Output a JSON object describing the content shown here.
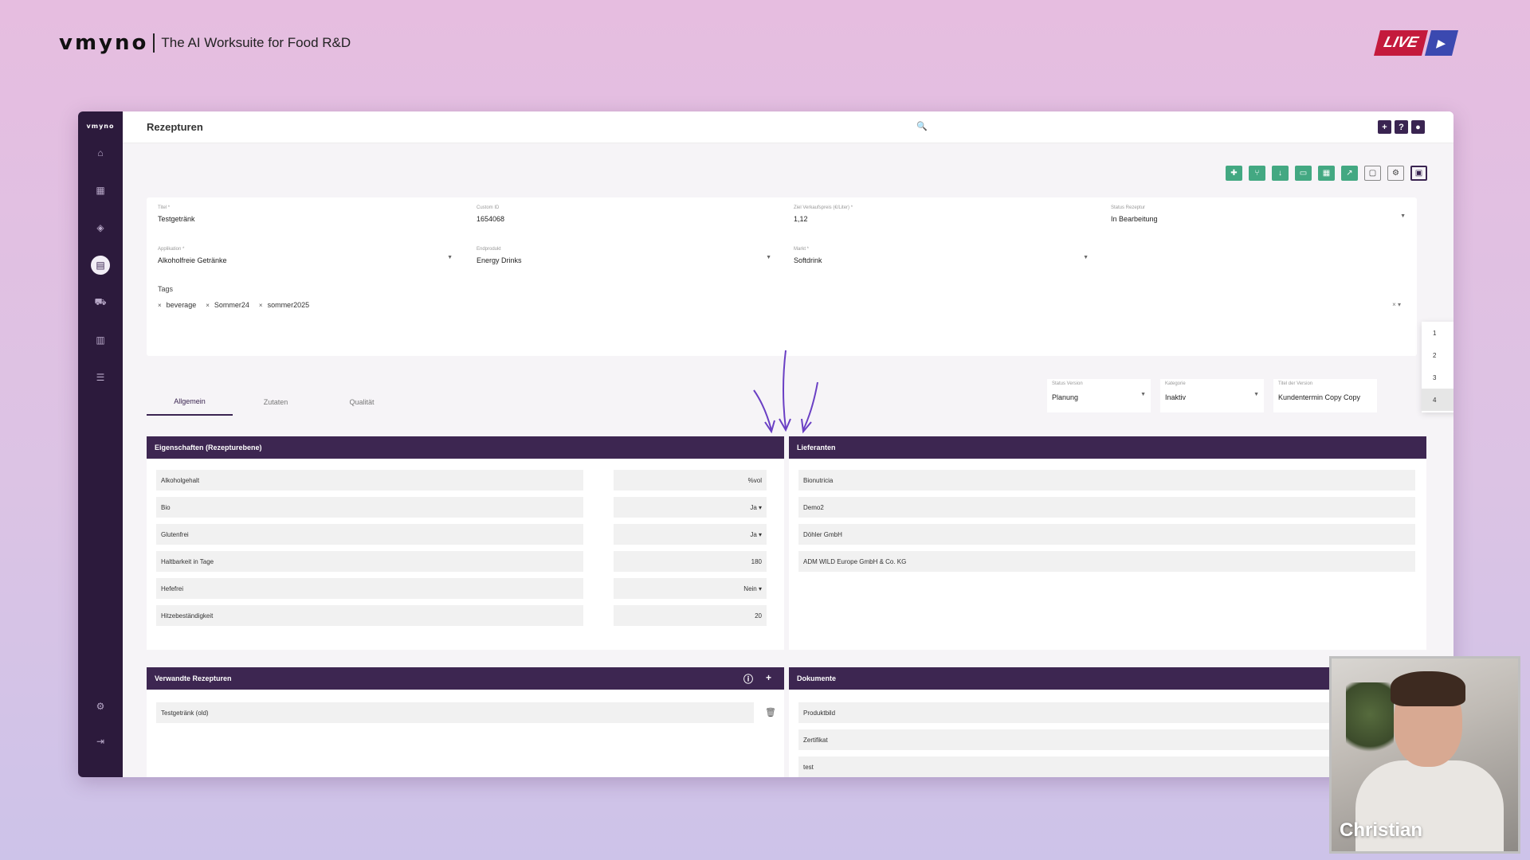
{
  "brand": {
    "logo": "vmyno",
    "tagline": "The AI Worksuite for Food R&D"
  },
  "live_badge": {
    "label": "LIVE"
  },
  "app": {
    "sidebar": {
      "logo": "vmyno",
      "items": [
        "home-icon",
        "grid-icon",
        "layers-icon",
        "recipe-icon",
        "truck-icon",
        "book-icon",
        "search-list-icon",
        "settings-icon",
        "logout-icon"
      ],
      "active": "recipe-icon"
    },
    "page_title": "Rezepturen",
    "top_actions": [
      "+",
      "?",
      "user-icon"
    ],
    "form": {
      "titel": {
        "label": "Titel *",
        "value": "Testgetränk"
      },
      "custom_id": {
        "label": "Custom ID",
        "value": "1654068"
      },
      "price": {
        "label": "Ziel Verkaufspreis (€/Liter) *",
        "value": "1,12"
      },
      "status": {
        "label": "Status Rezeptur",
        "value": "In Bearbeitung"
      },
      "applikation": {
        "label": "Applikation *",
        "value": "Alkoholfreie Getränke"
      },
      "endprodukt": {
        "label": "Endprodukt",
        "value": "Energy Drinks"
      },
      "markt": {
        "label": "Markt *",
        "value": "Softdrink"
      },
      "tags_label": "Tags",
      "tags": [
        "beverage",
        "Sommer24",
        "sommer2025"
      ]
    },
    "version_dropdown": [
      "1",
      "2",
      "3",
      "4"
    ],
    "tabs": [
      "Allgemein",
      "Zutaten",
      "Qualität"
    ],
    "version_fields": {
      "status_version": {
        "label": "Status Version",
        "value": "Planung"
      },
      "kategorie": {
        "label": "Kategorie",
        "value": "Inaktiv"
      },
      "titel_version": {
        "label": "Titel der Version",
        "value": "Kundentermin Copy Copy"
      }
    },
    "eigenschaften": {
      "title": "Eigenschaften (Rezepturebene)",
      "rows": [
        {
          "name": "Alkoholgehalt",
          "value": "%vol"
        },
        {
          "name": "Bio",
          "value": "Ja ▾"
        },
        {
          "name": "Glutenfrei",
          "value": "Ja ▾"
        },
        {
          "name": "Haltbarkeit in Tage",
          "value": "180"
        },
        {
          "name": "Hefefrei",
          "value": "Nein ▾"
        },
        {
          "name": "Hitzebeständigkeit",
          "value": "20"
        }
      ]
    },
    "lieferanten": {
      "title": "Lieferanten",
      "items": [
        "Bionutricia",
        "Demo2",
        "Döhler GmbH",
        "ADM WILD Europe GmbH & Co. KG"
      ]
    },
    "verwandte": {
      "title": "Verwandte Rezepturen",
      "items": [
        "Testgetränk (old)"
      ]
    },
    "dokumente": {
      "title": "Dokumente",
      "items": [
        "Produktbild",
        "Zertifikat",
        "test"
      ]
    }
  },
  "webcam": {
    "name": "Christian"
  }
}
